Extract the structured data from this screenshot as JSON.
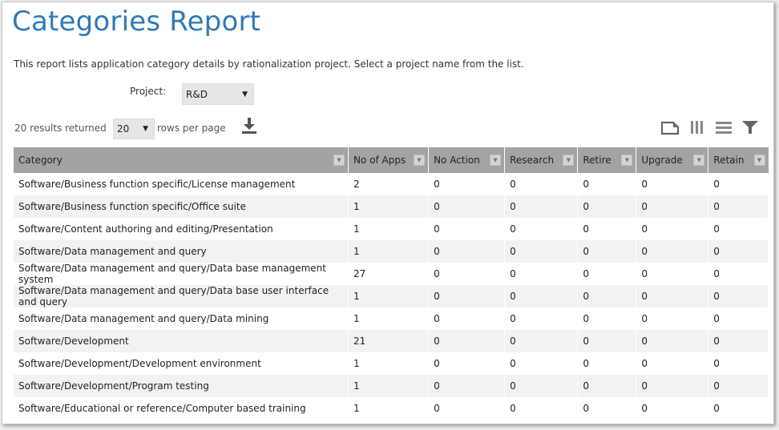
{
  "page": {
    "title": "Categories Report",
    "description": "This report lists application category details by rationalization project. Select a project name from the list."
  },
  "project": {
    "label": "Project:",
    "selected": "R&D"
  },
  "pagination": {
    "results_text": "20 results returned",
    "rows_selected": "20",
    "rows_label": "rows per page"
  },
  "toolbar": {
    "icons": [
      "download-icon",
      "export-icon",
      "columns-icon",
      "rows-icon",
      "filter-icon"
    ]
  },
  "colors": {
    "title": "#2f7ab8",
    "header_bg": "#a3a3a3",
    "row_alt": "#f2f2f2"
  },
  "table": {
    "columns": [
      "Category",
      "No of Apps",
      "No Action",
      "Research",
      "Retire",
      "Upgrade",
      "Retain"
    ],
    "rows": [
      [
        "Software/Business function specific/License management",
        "2",
        "0",
        "0",
        "0",
        "0",
        "0"
      ],
      [
        "Software/Business function specific/Office suite",
        "1",
        "0",
        "0",
        "0",
        "0",
        "0"
      ],
      [
        "Software/Content authoring and editing/Presentation",
        "1",
        "0",
        "0",
        "0",
        "0",
        "0"
      ],
      [
        "Software/Data management and query",
        "1",
        "0",
        "0",
        "0",
        "0",
        "0"
      ],
      [
        "Software/Data management and query/Data base management system",
        "27",
        "0",
        "0",
        "0",
        "0",
        "0"
      ],
      [
        "Software/Data management and query/Data base user interface and query",
        "1",
        "0",
        "0",
        "0",
        "0",
        "0"
      ],
      [
        "Software/Data management and query/Data mining",
        "1",
        "0",
        "0",
        "0",
        "0",
        "0"
      ],
      [
        "Software/Development",
        "21",
        "0",
        "0",
        "0",
        "0",
        "0"
      ],
      [
        "Software/Development/Development environment",
        "1",
        "0",
        "0",
        "0",
        "0",
        "0"
      ],
      [
        "Software/Development/Program testing",
        "1",
        "0",
        "0",
        "0",
        "0",
        "0"
      ],
      [
        "Software/Educational or reference/Computer based training",
        "1",
        "0",
        "0",
        "0",
        "0",
        "0"
      ]
    ]
  }
}
